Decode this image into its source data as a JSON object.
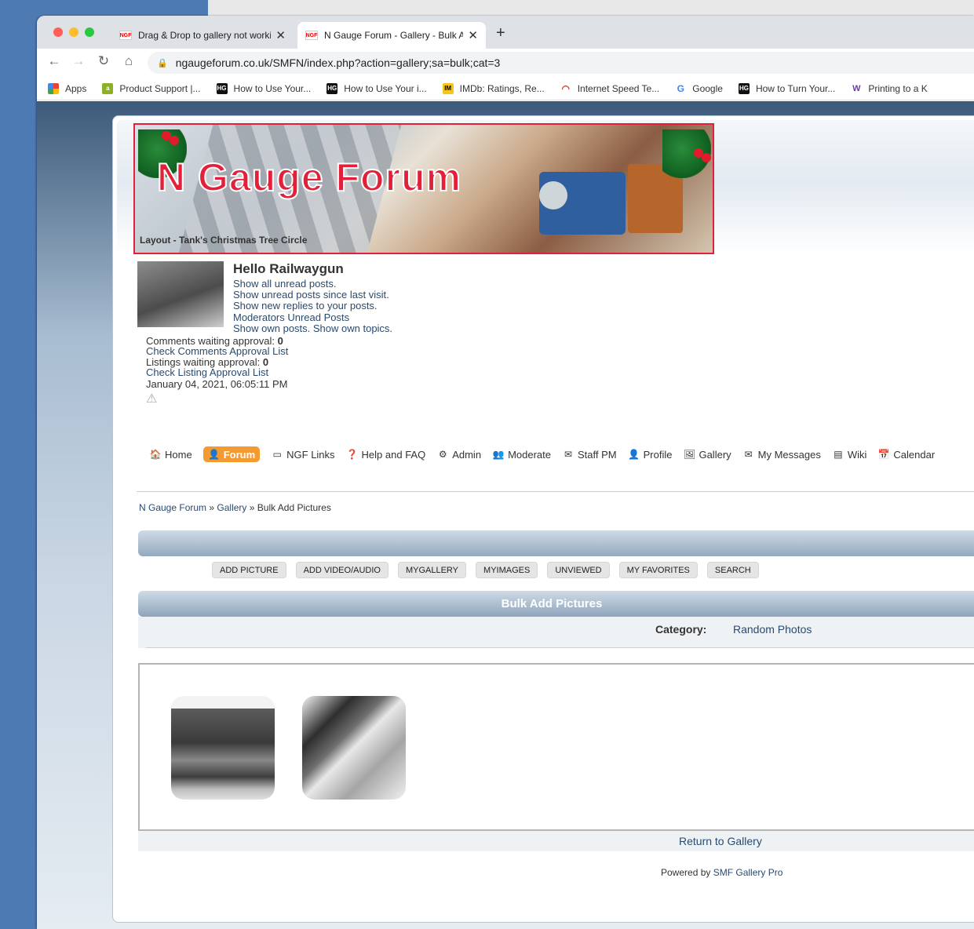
{
  "browser": {
    "tabs": [
      {
        "title": "Drag & Drop to gallery not working",
        "favicon": "NGF"
      },
      {
        "title": "N Gauge Forum - Gallery - Bulk Add Pictures",
        "favicon": "NGF"
      }
    ],
    "url": "ngaugeforum.co.uk/SMFN/index.php?action=gallery;sa=bulk;cat=3",
    "bookmarks": [
      {
        "label": "Apps",
        "icon": "apps-grid-icon",
        "color": "#e94235"
      },
      {
        "label": "Product Support |...",
        "icon": "product-support-icon",
        "color": "#8ab024"
      },
      {
        "label": "How to Use Your...",
        "icon": "htg-icon",
        "color": "#111111"
      },
      {
        "label": "How to Use Your i...",
        "icon": "htg-icon",
        "color": "#111111"
      },
      {
        "label": "IMDb: Ratings, Re...",
        "icon": "imdb-icon",
        "color": "#f5c518"
      },
      {
        "label": "Internet Speed Te...",
        "icon": "speedtest-icon",
        "color": "#d93025"
      },
      {
        "label": "Google",
        "icon": "google-icon",
        "color": "#4285f4"
      },
      {
        "label": "How to Turn Your...",
        "icon": "htg-icon",
        "color": "#111111"
      },
      {
        "label": "Printing to a K",
        "icon": "printing-icon",
        "color": "#6a3fa0"
      }
    ]
  },
  "banner": {
    "title": "N Gauge Forum",
    "caption": "Layout - Tank's Christmas Tree Circle"
  },
  "user": {
    "greeting": "Hello Railwaygun",
    "links": [
      "Show all unread posts.",
      "Show unread posts since last visit.",
      "Show new replies to your posts.",
      "Moderators Unread Posts",
      "Show own posts. Show own topics."
    ],
    "comments_waiting_label": "Comments waiting approval:",
    "comments_waiting": "0",
    "check_comments": "Check Comments Approval List",
    "listings_waiting_label": "Listings waiting approval:",
    "listings_waiting": "0",
    "check_listings": "Check Listing Approval List",
    "datetime": "January 04, 2021, 06:05:11 PM"
  },
  "menu": [
    {
      "label": "Home",
      "icon": "home-icon",
      "active": false
    },
    {
      "label": "Forum",
      "icon": "forum-icon",
      "active": true
    },
    {
      "label": "NGF Links",
      "icon": "links-icon",
      "active": false
    },
    {
      "label": "Help and FAQ",
      "icon": "help-icon",
      "active": false
    },
    {
      "label": "Admin",
      "icon": "admin-gear-icon",
      "active": false
    },
    {
      "label": "Moderate",
      "icon": "moderate-icon",
      "active": false
    },
    {
      "label": "Staff PM",
      "icon": "staff-pm-icon",
      "active": false
    },
    {
      "label": "Profile",
      "icon": "profile-icon",
      "active": false
    },
    {
      "label": "Gallery",
      "icon": "gallery-icon",
      "active": false
    },
    {
      "label": "My Messages",
      "icon": "messages-icon",
      "active": false
    },
    {
      "label": "Wiki",
      "icon": "wiki-icon",
      "active": false
    },
    {
      "label": "Calendar",
      "icon": "calendar-icon",
      "active": false
    }
  ],
  "breadcrumb": [
    "N Gauge Forum",
    "Gallery",
    "Bulk Add Pictures"
  ],
  "gallery_buttons": [
    "ADD PICTURE",
    "ADD VIDEO/AUDIO",
    "MYGALLERY",
    "MYIMAGES",
    "UNVIEWED",
    "MY FAVORITES",
    "SEARCH"
  ],
  "bulk": {
    "title": "Bulk Add Pictures",
    "category_label": "Category:",
    "category_value": "Random Photos",
    "return_link": "Return to Gallery"
  },
  "footer": {
    "powered_by": "Powered by",
    "product": "SMF Gallery Pro"
  },
  "colors": {
    "accent_orange": "#f49a31",
    "banner_red": "#e2203a",
    "link_blue": "#2a4a6e"
  }
}
